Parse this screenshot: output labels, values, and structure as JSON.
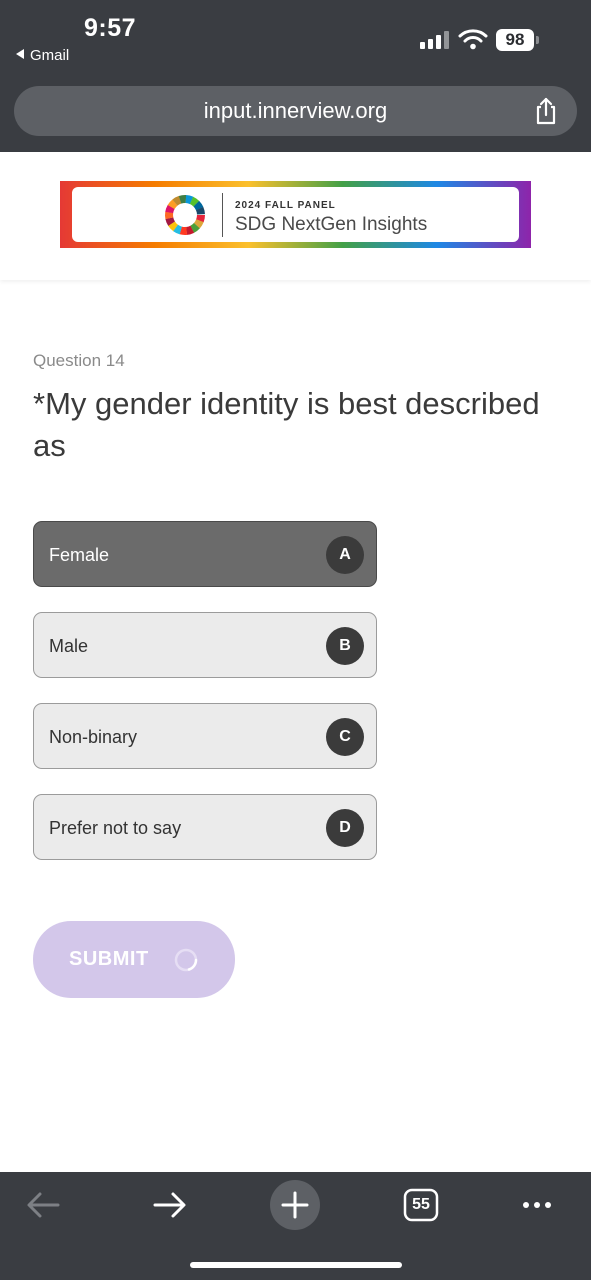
{
  "status_bar": {
    "time": "9:57",
    "back_app": "Gmail",
    "battery": "98"
  },
  "browser": {
    "url": "input.innerview.org",
    "tab_count": "55"
  },
  "banner": {
    "kicker": "2024 FALL PANEL",
    "title": "SDG NextGen Insights"
  },
  "question": {
    "number": "Question 14",
    "text": "*My gender identity is best described as"
  },
  "options": [
    {
      "label": "Female",
      "key": "A",
      "selected": true
    },
    {
      "label": "Male",
      "key": "B",
      "selected": false
    },
    {
      "label": "Non-binary",
      "key": "C",
      "selected": false
    },
    {
      "label": "Prefer not to say",
      "key": "D",
      "selected": false
    }
  ],
  "submit": {
    "label": "SUBMIT"
  },
  "colors": {
    "chrome": "#3a3d42",
    "selected_option": "#6b6b6b",
    "submit_disabled": "#d3c7ea"
  },
  "icons": {
    "back": "arrow-left-icon",
    "forward": "arrow-right-icon",
    "new_tab": "plus-icon",
    "tabs": "tabs-icon",
    "more": "more-icon",
    "share": "share-icon"
  }
}
